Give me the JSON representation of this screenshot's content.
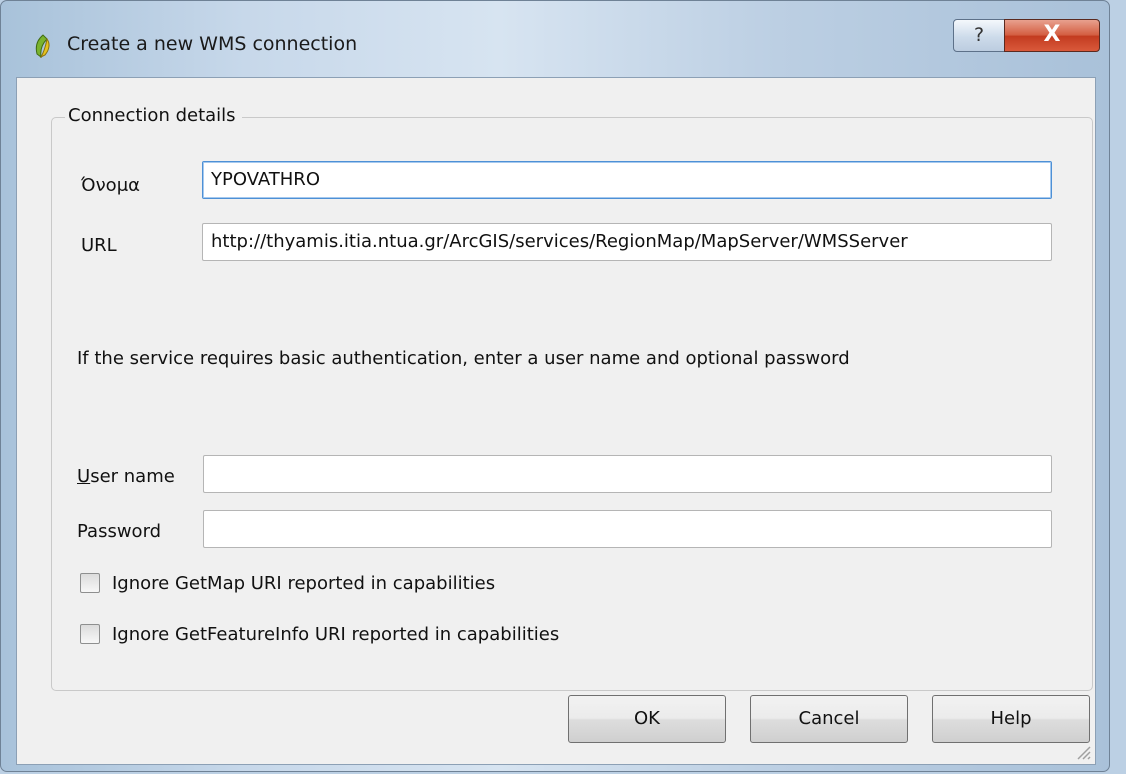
{
  "window": {
    "title": "Create a new WMS connection"
  },
  "titlebar": {
    "help_glyph": "?",
    "close_glyph": "X"
  },
  "group": {
    "legend": "Connection details"
  },
  "form": {
    "name": {
      "label": "Όνομα",
      "value": "YPOVATHRO"
    },
    "url": {
      "label": "URL",
      "value": "http://thyamis.itia.ntua.gr/ArcGIS/services/RegionMap/MapServer/WMSServer"
    },
    "auth_info": "If the service requires basic authentication, enter a user name and optional password",
    "username": {
      "label_underlined": "U",
      "label_rest": "ser name",
      "value": ""
    },
    "password": {
      "label": "Password",
      "value": ""
    },
    "ignore_getmap": {
      "label": "Ignore GetMap URI reported in capabilities",
      "checked": false
    },
    "ignore_getfeatureinfo": {
      "label": "Ignore GetFeatureInfo URI reported in capabilities",
      "checked": false
    }
  },
  "buttons": {
    "ok": "OK",
    "cancel": "Cancel",
    "help": "Help"
  },
  "icons": {
    "app": "qgis-icon",
    "help": "help-icon",
    "close": "close-icon",
    "resize": "resize-grip-icon"
  },
  "colors": {
    "close_button": "#c94a2e",
    "focus_border": "#4d90d6",
    "dialog_bg": "#f0f0f0"
  }
}
